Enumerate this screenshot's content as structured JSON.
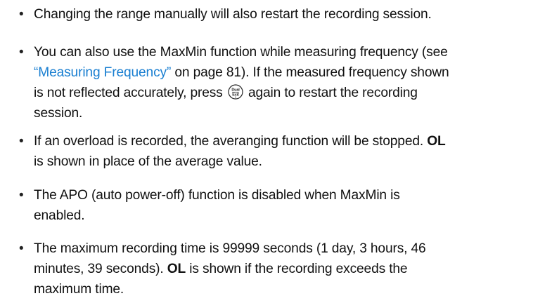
{
  "bullet_glyph": "•",
  "items": [
    {
      "lines": {
        "l1": "Changing the range manually will also restart the recording session."
      }
    },
    {
      "lines": {
        "l1": "You can also use the MaxMin function while measuring frequency (see",
        "l2_link": "“Measuring Frequency”",
        "l2_rest": " on page 81). If the measured frequency shown",
        "l3_a": "is not reflected accurately, press ",
        "l3_b": " again to restart the recording",
        "l4": "session."
      },
      "key_icon": "dual-exit-key-icon"
    },
    {
      "lines": {
        "l1_a": "If an overload is recorded, the averanging function will be stopped. ",
        "l1_bold": "OL",
        "l2": "is shown in place of the average value."
      }
    },
    {
      "lines": {
        "l1": "The APO (auto power-off) function is disabled when MaxMin is",
        "l2": "enabled."
      }
    },
    {
      "lines": {
        "l1": "The maximum recording time is 99999 seconds (1 day, 3 hours, 46",
        "l2_a": "minutes, 39 seconds). ",
        "l2_bold": "OL",
        "l2_b": " is shown if the recording exceeds the",
        "l3": "maximum time."
      }
    }
  ],
  "key_label": {
    "top": "Dual",
    "bottom": "Exit"
  },
  "colors": {
    "link": "#1a7fd1",
    "text": "#111111"
  }
}
